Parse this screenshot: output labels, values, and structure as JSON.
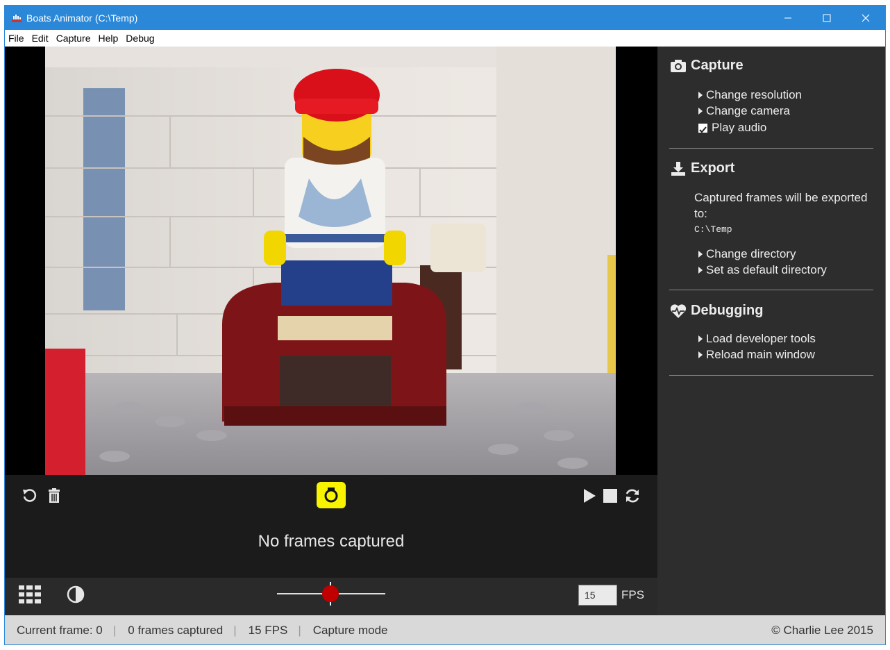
{
  "window": {
    "title": "Boats Animator (C:\\Temp)"
  },
  "menu": [
    "File",
    "Edit",
    "Capture",
    "Help",
    "Debug"
  ],
  "viewer": {
    "status_message": "No frames captured"
  },
  "playback": {
    "fps_value": "15",
    "fps_label": "FPS",
    "onion_skin_level": 0.5
  },
  "sidebar": {
    "capture": {
      "title": "Capture",
      "items": [
        "Change resolution",
        "Change camera"
      ],
      "play_audio_label": "Play audio",
      "play_audio_checked": true
    },
    "export": {
      "title": "Export",
      "description": "Captured frames will be exported to:",
      "path": "C:\\Temp",
      "items": [
        "Change directory",
        "Set as default directory"
      ]
    },
    "debugging": {
      "title": "Debugging",
      "items": [
        "Load developer tools",
        "Reload main window"
      ]
    }
  },
  "statusbar": {
    "current_frame": "Current frame: 0",
    "frames_captured": "0 frames captured",
    "fps": "15 FPS",
    "mode": "Capture mode",
    "copyright": "© Charlie Lee 2015"
  },
  "colors": {
    "accent": "#2b88d8",
    "capture_button": "#f8f400",
    "slider_thumb": "#c00000"
  },
  "icons": [
    "app-icon",
    "minimize-icon",
    "maximize-icon",
    "close-icon",
    "undo-icon",
    "trash-icon",
    "camera-icon",
    "play-icon",
    "stop-icon",
    "loop-icon",
    "grid-icon",
    "contrast-icon",
    "download-icon",
    "heartbeat-icon"
  ]
}
